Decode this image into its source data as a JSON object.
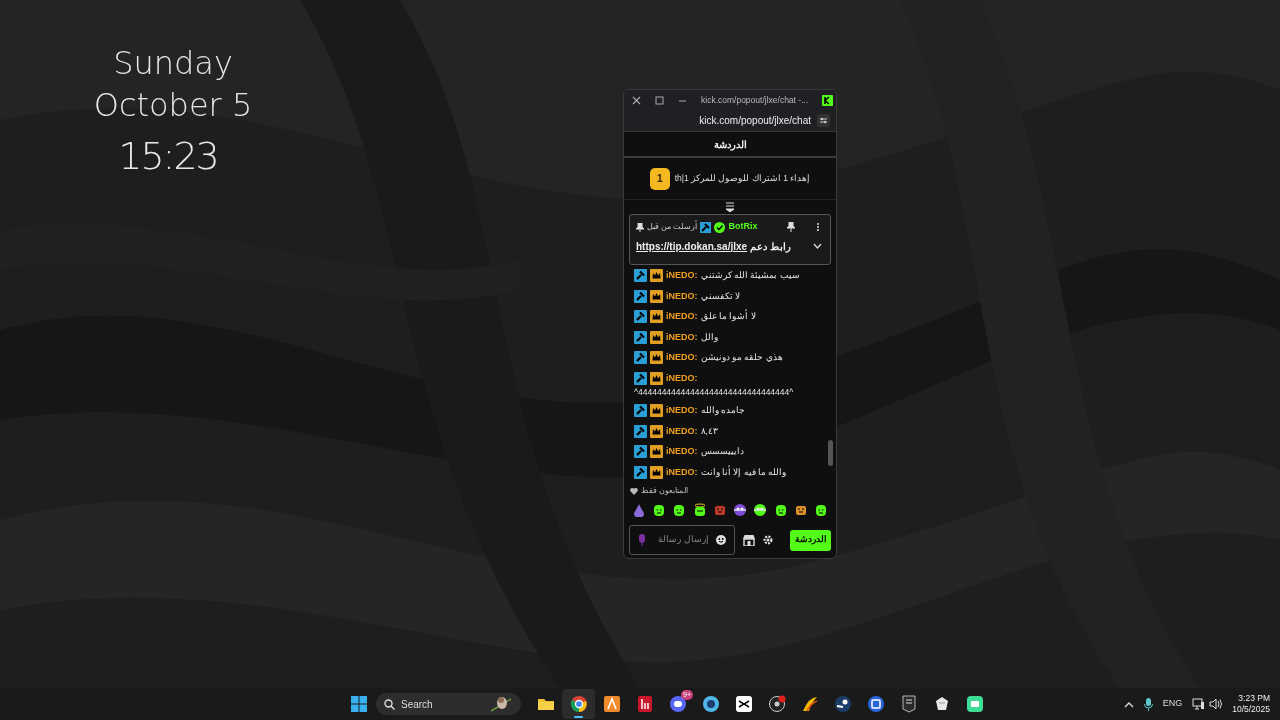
{
  "desktop_clock": {
    "day": "Sunday",
    "date": "October 5",
    "time": "15:23"
  },
  "browser": {
    "tab_title": "kick.com/popout/jlxe/chat -...",
    "address": "kick.com/popout/jlxe/chat"
  },
  "chat": {
    "header": "الدردشة",
    "gift_banner": {
      "rank": "1",
      "text": "th|إهداء 1 اشتراك للوصول للمركز 1"
    },
    "pinned": {
      "sender": "BotRix",
      "sent_by": "أرسلت من قبل",
      "message": "رابط دعم",
      "link": "https://tip.dokan.sa/jlxe"
    },
    "messages": [
      {
        "user": "iNEDO:",
        "text": "سيب بمشيئة الله كرشتني"
      },
      {
        "user": "iNEDO:",
        "text": "لا تكفسني"
      },
      {
        "user": "iNEDO:",
        "text": "لا أشوا ما علق"
      },
      {
        "user": "iNEDO:",
        "text": "والل"
      },
      {
        "user": "iNEDO:",
        "text": "هذي حلقه مو دونيشن"
      },
      {
        "user": "iNEDO:",
        "text": "^44444444444444444444444444444444^"
      },
      {
        "user": "iNEDO:",
        "text": "جامده والله"
      },
      {
        "user": "iNEDO:",
        "text": "٨,٤٣"
      },
      {
        "user": "iNEDO:",
        "text": "دايييسسس"
      },
      {
        "user": "iNEDO:",
        "text": "والله ما فيه إلا أنا وانت"
      }
    ],
    "followers_only": "المتابعون فقط",
    "input": {
      "placeholder": "إرسال رسالة"
    },
    "send_button": "الدردشة"
  },
  "taskbar": {
    "search_placeholder": "Search",
    "apps": [
      {
        "selected": false
      },
      {
        "selected": true
      },
      {
        "selected": false
      },
      {
        "selected": false
      },
      {
        "selected": false,
        "badge": "9+"
      },
      {
        "selected": false
      },
      {
        "selected": false
      },
      {
        "selected": false
      },
      {
        "selected": false
      },
      {
        "selected": false
      },
      {
        "selected": false
      },
      {
        "selected": false
      },
      {
        "selected": false
      },
      {
        "selected": false
      }
    ],
    "language": "ENG",
    "time": "3:23 PM",
    "date": "10/5/2025"
  }
}
